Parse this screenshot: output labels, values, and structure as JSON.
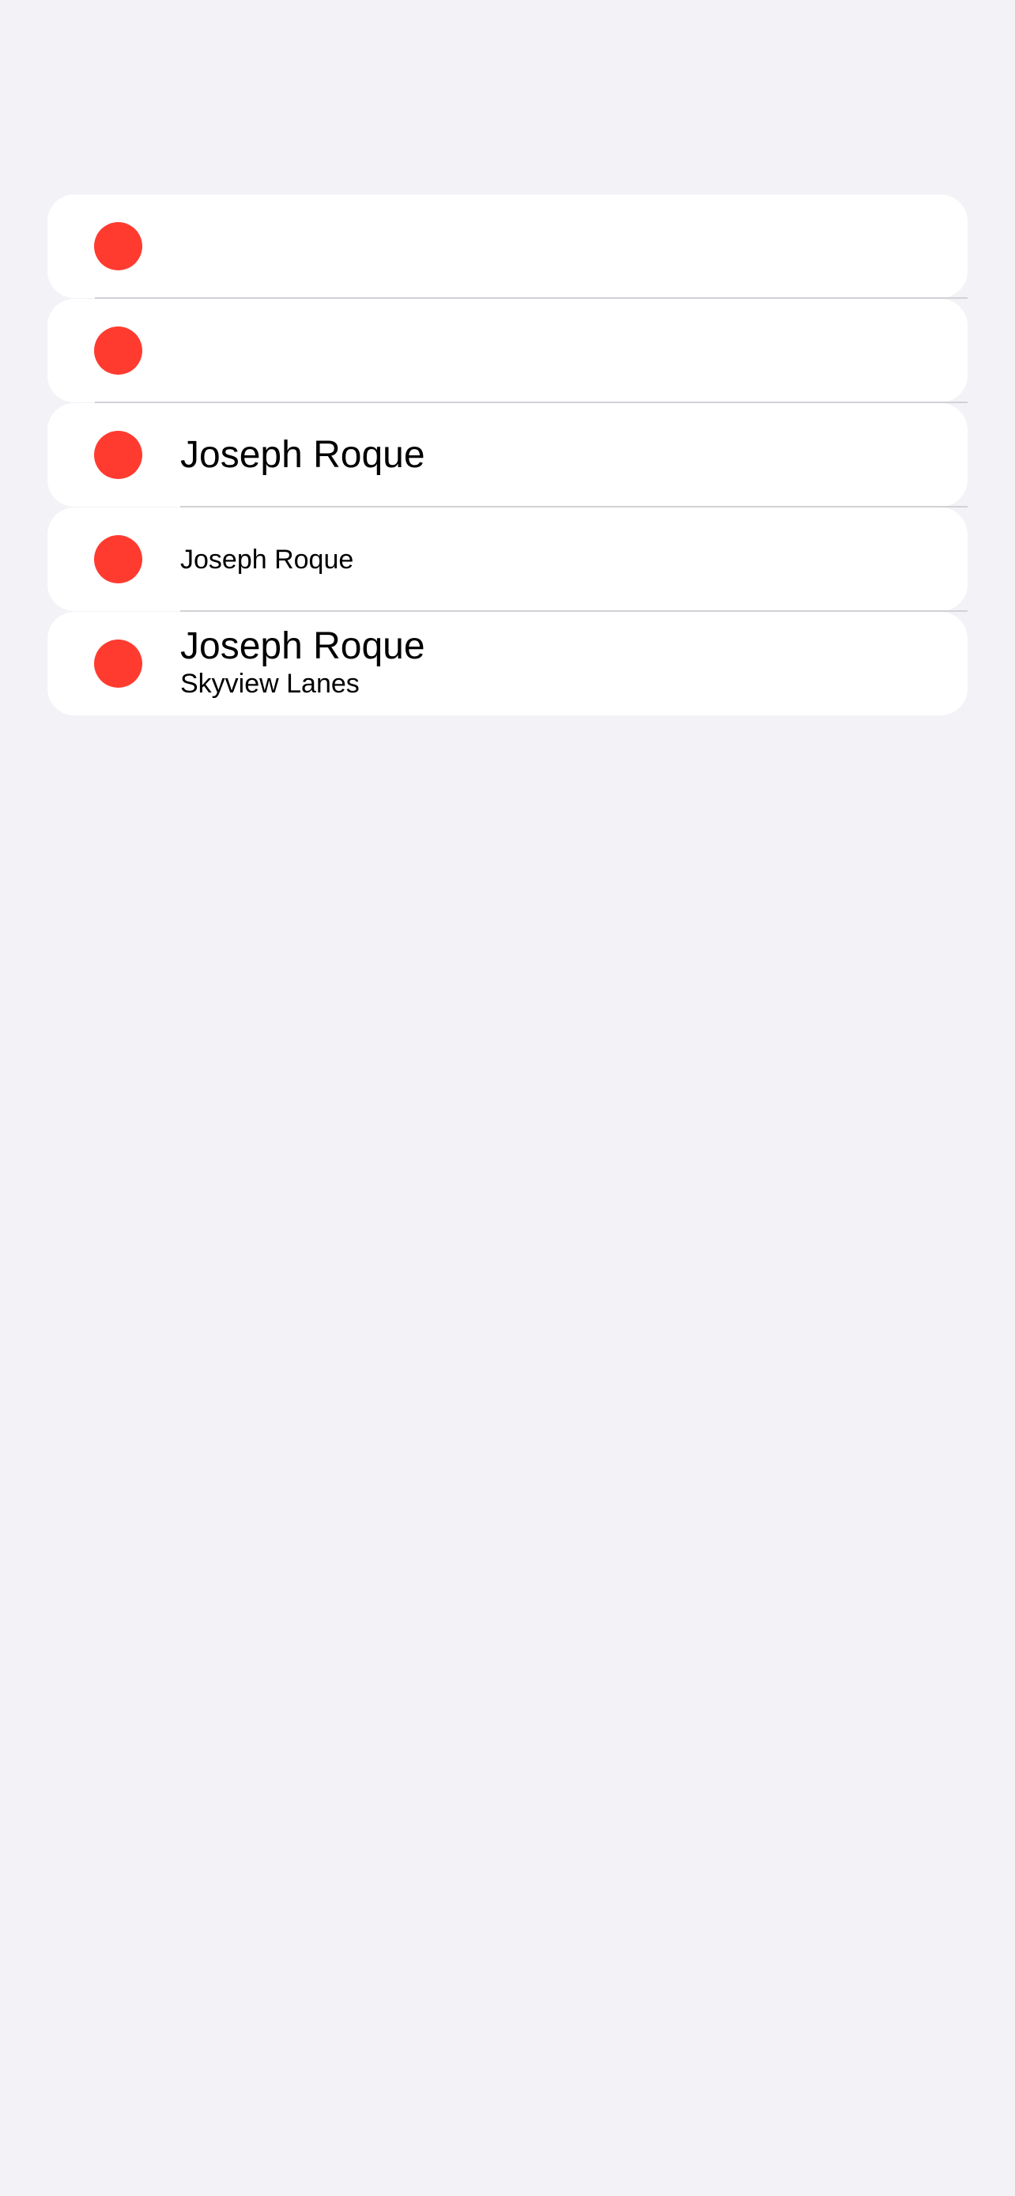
{
  "theme": {
    "background": "#f2f2f7",
    "row_background": "#ffffff",
    "indicator_color": "#ff3b30",
    "separator_color": "#d1d1d6"
  },
  "list": {
    "rows": [
      {
        "indicator": "red-circle-icon"
      },
      {
        "indicator": "red-circle-icon"
      },
      {
        "indicator": "red-circle-icon",
        "title": "Joseph Roque"
      },
      {
        "indicator": "red-circle-icon",
        "title": "Joseph Roque"
      },
      {
        "indicator": "red-circle-icon",
        "title": "Joseph Roque",
        "subtitle": "Skyview Lanes"
      }
    ]
  }
}
